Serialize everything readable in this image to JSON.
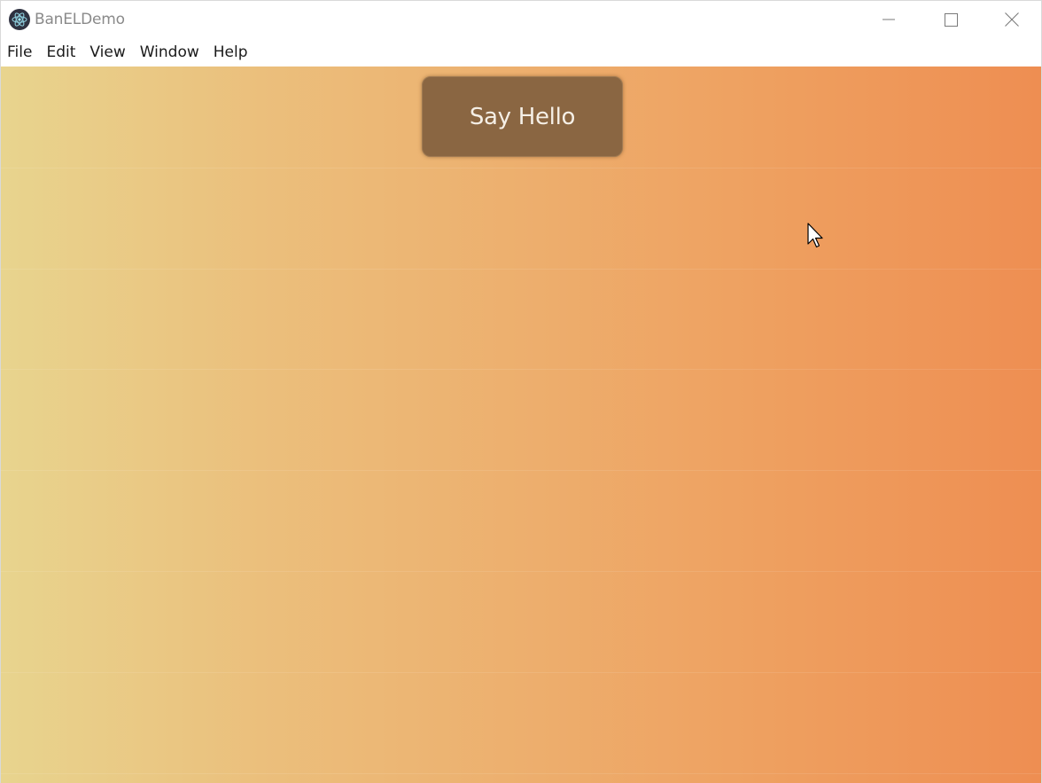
{
  "window": {
    "title": "BanELDemo",
    "controls": {
      "minimize": "minimize-icon",
      "maximize": "maximize-icon",
      "close": "close-icon"
    }
  },
  "menubar": {
    "items": [
      {
        "label": "File"
      },
      {
        "label": "Edit"
      },
      {
        "label": "View"
      },
      {
        "label": "Window"
      },
      {
        "label": "Help"
      }
    ]
  },
  "main": {
    "say_hello_label": "Say Hello",
    "background": {
      "gradient_start": "#e8d48e",
      "gradient_end": "#ee8e52"
    },
    "button_color": "#8a6642"
  }
}
